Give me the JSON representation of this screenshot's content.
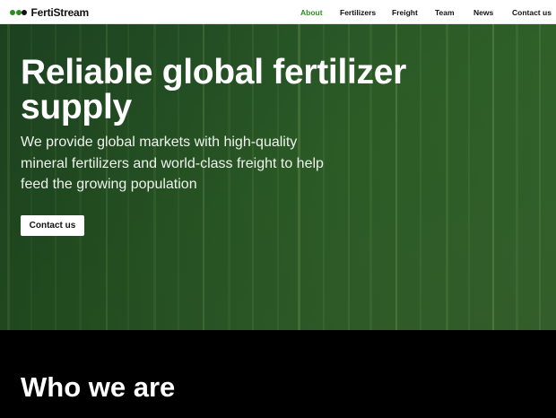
{
  "header": {
    "logo_text": "FertiStream",
    "logo_colors": [
      "#2f8a23",
      "#2f8a23",
      "#111111"
    ],
    "nav": [
      {
        "label": "About",
        "active": true
      },
      {
        "label": "Fertilizers",
        "active": false
      },
      {
        "label": "Freight",
        "active": false
      },
      {
        "label": "Team",
        "active": false
      },
      {
        "label": "News",
        "active": false
      },
      {
        "label": "Contact us",
        "active": false
      }
    ]
  },
  "hero": {
    "title": "Reliable global fertilizer supply",
    "description": "We provide global markets with high-quality mineral fertilizers and world-class freight to help feed the growing population",
    "cta_label": "Contact us",
    "background": "green crop field, aerial view"
  },
  "section": {
    "title": "Who we are"
  },
  "colors": {
    "accent": "#2f8a23",
    "hero_bg": "#2c5a28",
    "section_bg": "#000000"
  }
}
